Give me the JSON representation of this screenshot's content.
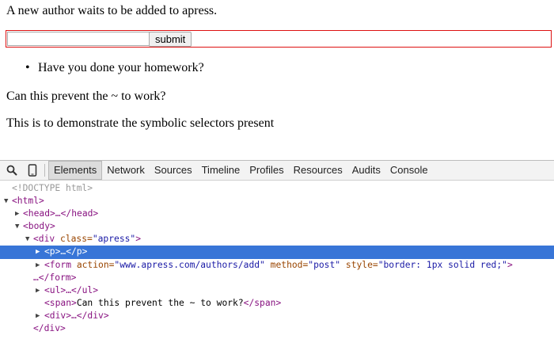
{
  "page": {
    "intro": "A new author waits to be added to apress.",
    "form": {
      "input_value": "",
      "submit_label": "submit"
    },
    "list_items": [
      "Have you done your homework?"
    ],
    "paragraph_tilde": "Can this prevent the ~ to work?",
    "paragraph_demo": "This is to demonstrate the symbolic selectors present"
  },
  "devtools": {
    "tabs": [
      "Elements",
      "Network",
      "Sources",
      "Timeline",
      "Profiles",
      "Resources",
      "Audits",
      "Console"
    ],
    "active_tab": "Elements",
    "selected_row": "<p>…</p>",
    "tree": {
      "doctype": "<!DOCTYPE html>",
      "html_open": "<html>",
      "head": "<head>…</head>",
      "body_open": "<body>",
      "div_open_tag": "<div ",
      "div_class_attr": "class=",
      "div_class_val": "\"apress\"",
      "div_close_bracket": ">",
      "p_row": "<p>…</p>",
      "form_tag": "<form ",
      "form_action_attr": "action=",
      "form_action_val": "\"www.apress.com/authors/add\"",
      "form_method_attr": " method=",
      "form_method_val": "\"post\"",
      "form_style_attr": " style=",
      "form_style_val": "\"border: 1px solid red;\"",
      "form_gt": ">",
      "form_close": "…</form>",
      "ul_row": "<ul>…</ul>",
      "span_open": "<span>",
      "span_text": "Can this prevent the ~ to work?",
      "span_close": "</span>",
      "div_row": "<div>…</div>",
      "div_close": "</div>"
    },
    "colors": {
      "selection": "#3875d7",
      "tag": "#881280",
      "attr_name": "#994500",
      "attr_value": "#1a1aa6"
    }
  }
}
